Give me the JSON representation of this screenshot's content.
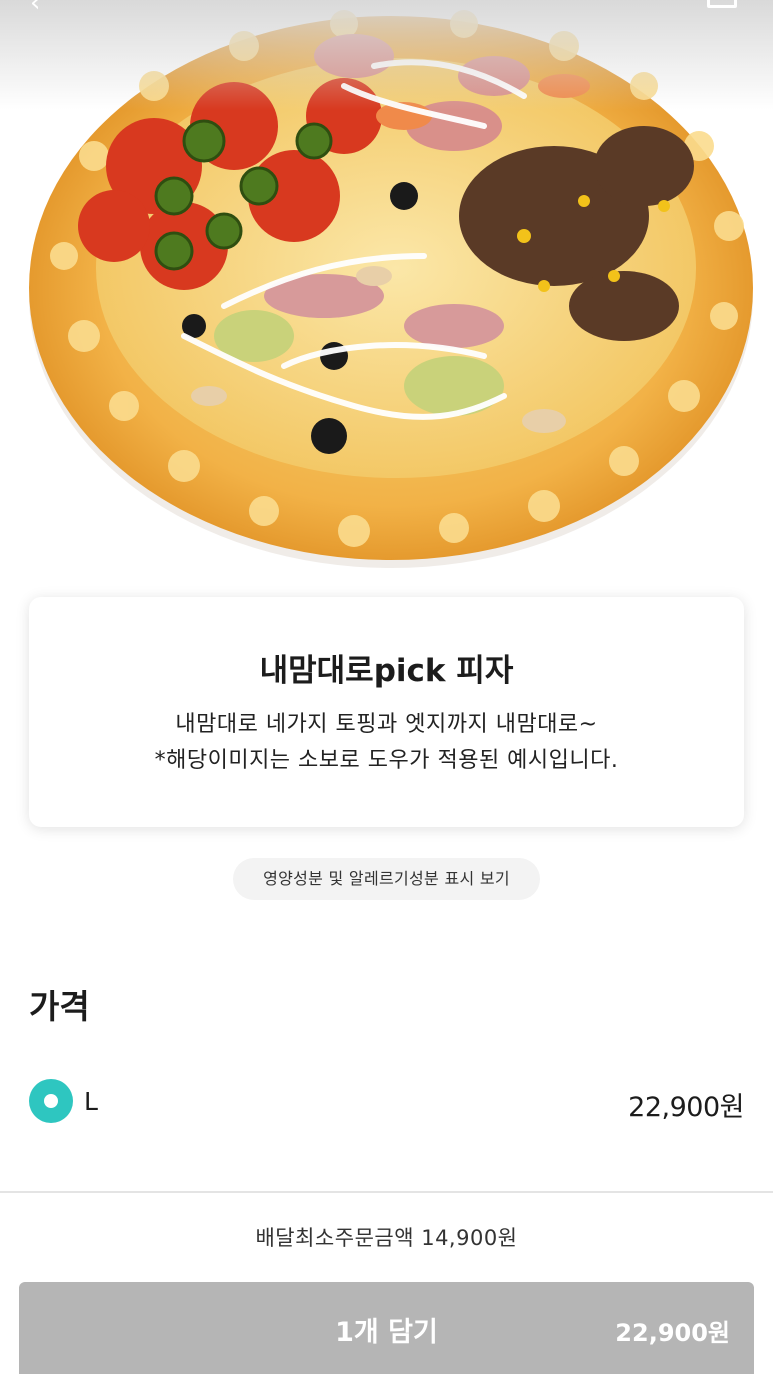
{
  "header": {
    "back_icon": "chevron-left-icon",
    "share_icon": "share-icon"
  },
  "product": {
    "image_subject": "four-topping pizza with crumble crust",
    "title": "내맘대로pick 피자",
    "description_line1": "내맘대로 네가지 토핑과 엣지까지 내맘대로~",
    "description_line2": "*해당이미지는 소보로 도우가 적용된 예시입니다."
  },
  "nutrition_button": {
    "label": "영양성분 및 알레르기성분 표시 보기"
  },
  "price_section": {
    "title": "가격",
    "options": [
      {
        "label": "L",
        "price": "22,900원",
        "selected": true
      }
    ]
  },
  "footer": {
    "min_order_text": "배달최소주문금액 14,900원",
    "cart_button_label": "1개 담기",
    "cart_button_price": "22,900원"
  },
  "colors": {
    "accent": "#2ec6c0",
    "cart_button": "#b5b5b5",
    "chip_bg": "#f3f3f3"
  }
}
